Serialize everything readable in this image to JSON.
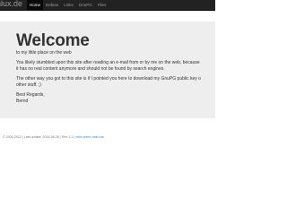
{
  "brand": {
    "text": "athlux.de"
  },
  "nav": {
    "items": [
      {
        "label": "Home",
        "active": true
      },
      {
        "label": "Debian",
        "active": false
      },
      {
        "label": "Links",
        "active": false
      },
      {
        "label": "GnuPG",
        "active": false
      },
      {
        "label": "Files",
        "active": false
      }
    ]
  },
  "jumbotron": {
    "heading": "Welcome",
    "lead": "to my little place on the web",
    "paragraph1_line1": "You likely stumbled upon this site after reading an e-mail from or by me on the web, because",
    "paragraph1_line2": "it has no real content anymore and should not be found by search engines.",
    "paragraph2_line1": "The other way you got to this site is if I pointed you here to download my GnuPG public key o",
    "paragraph2_line2": "other stuff. ;)",
    "closing": "Best Regards,",
    "signature": "Bernd"
  },
  "footer": {
    "copyright": "© 2005-2012 | Last update: 2016-06-28 | Rev 1.1 |",
    "validation_links": "valid xhtml valid css"
  },
  "colors": {
    "navbar_bg": "#222222",
    "jumbotron_bg": "#eeeeee",
    "link": "#428bca"
  }
}
